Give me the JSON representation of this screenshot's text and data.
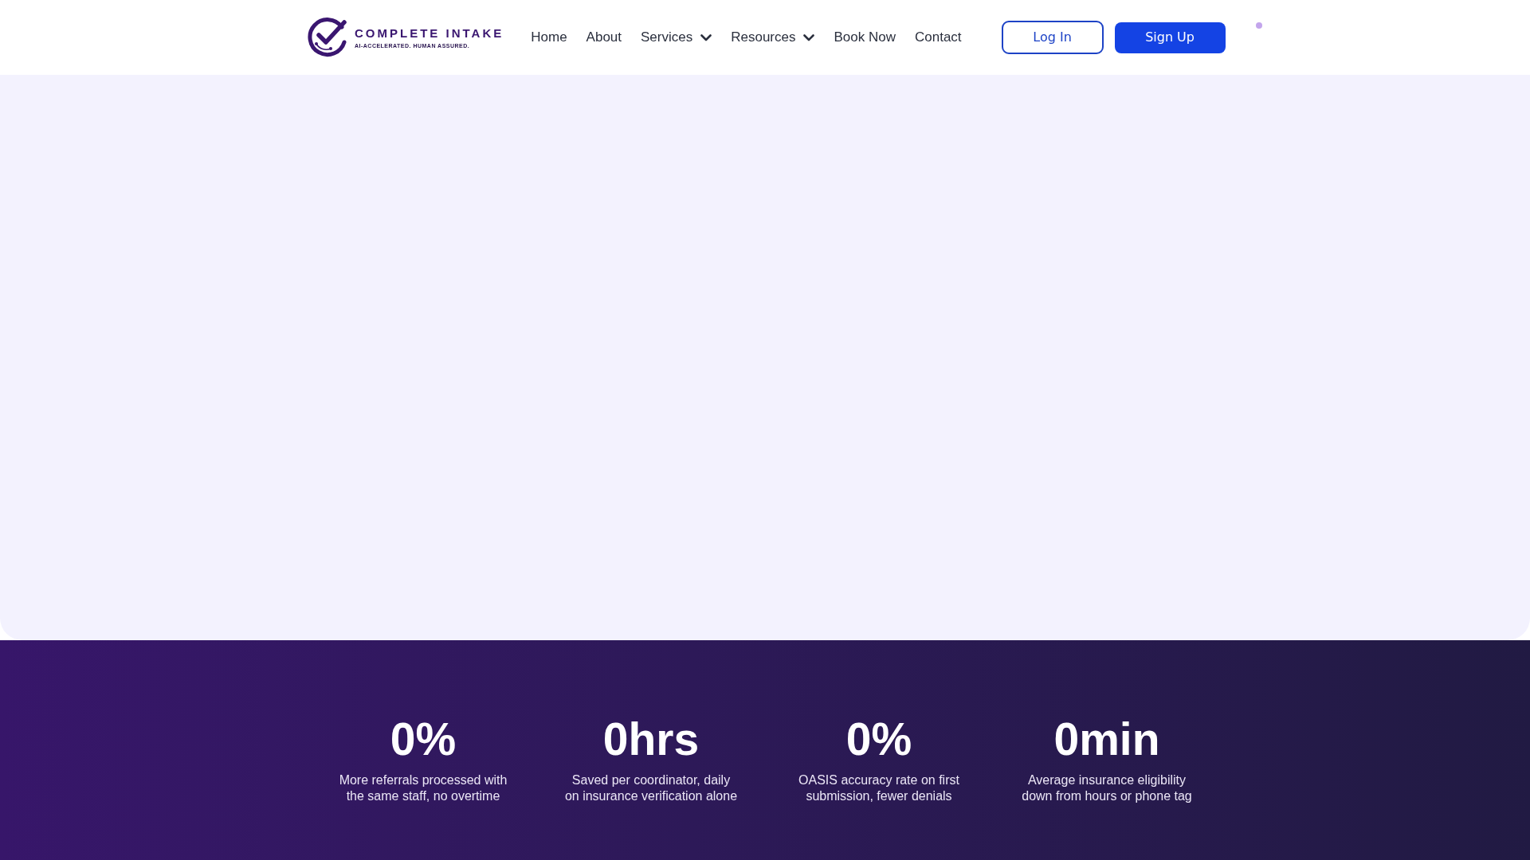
{
  "header": {
    "logo": {
      "name": "COMPLETE INTAKE",
      "tagline": "AI-ACCELERATED. HUMAN ASSURED."
    },
    "nav": [
      {
        "label": "Home",
        "kind": "link"
      },
      {
        "label": "About",
        "kind": "link"
      },
      {
        "label": "Services",
        "kind": "dropdown"
      },
      {
        "label": "Resources",
        "kind": "dropdown"
      },
      {
        "label": "Book Now",
        "kind": "link"
      },
      {
        "label": "Contact",
        "kind": "link"
      }
    ],
    "buttons": [
      {
        "label": "Log In",
        "kind": "outline"
      },
      {
        "label": "Sign Up",
        "kind": "primary"
      }
    ]
  },
  "stats": [
    {
      "value": "0%",
      "description": [
        "More referrals processed with",
        "the same staff, no overtime"
      ]
    },
    {
      "value": "0hrs",
      "description": [
        "Saved per coordinator, daily",
        "on insurance verification alone"
      ]
    },
    {
      "value": "0%",
      "description": [
        "OASIS accuracy rate on first",
        "submission, fewer denials"
      ]
    },
    {
      "value": "0min",
      "description": [
        "Average insurance eligibility",
        "down from hours or phone tag"
      ]
    }
  ]
}
